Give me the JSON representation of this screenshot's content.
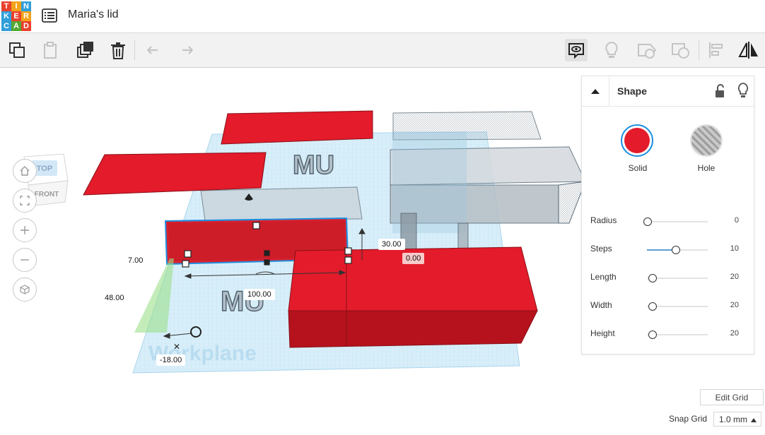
{
  "app": {
    "logo_letters": [
      "T",
      "I",
      "N",
      "K",
      "E",
      "R",
      "C",
      "A",
      "D"
    ],
    "design_title": "Maria's lid"
  },
  "colors": {
    "solid_red": "#e31b2b",
    "accent_blue": "#1f8fe0",
    "grid_blue": "#9fd3ee",
    "toolbar_bg": "#f2f2f2"
  },
  "toolbar": {
    "buttons": [
      {
        "name": "copy-icon",
        "enabled": true
      },
      {
        "name": "paste-icon",
        "enabled": false
      },
      {
        "name": "duplicate-icon",
        "enabled": true
      },
      {
        "name": "delete-icon",
        "enabled": true
      },
      {
        "name": "undo-icon",
        "enabled": false
      },
      {
        "name": "redo-icon",
        "enabled": false
      },
      {
        "name": "notes-icon",
        "enabled": true
      },
      {
        "name": "show-all-icon",
        "enabled": false
      },
      {
        "name": "group-icon",
        "enabled": false
      },
      {
        "name": "ungroup-icon",
        "enabled": false
      },
      {
        "name": "align-icon",
        "enabled": false
      },
      {
        "name": "mirror-icon",
        "enabled": true
      }
    ]
  },
  "viewcube": {
    "top": "TOP",
    "front": "FRONT"
  },
  "nav": [
    "home-icon",
    "fit-icon",
    "zoom-in-icon",
    "zoom-out-icon",
    "ortho-icon"
  ],
  "workplane_label": "Workplane",
  "scene_text": "MU",
  "dimensions": {
    "elevation": "7.00",
    "depth": "48.00",
    "height": "30.00",
    "rotation": "0.00",
    "length": "100.00",
    "offset": "-18.00"
  },
  "inspector": {
    "title": "Shape",
    "solid_label": "Solid",
    "hole_label": "Hole",
    "props": [
      {
        "name": "Radius",
        "value": "0",
        "pos": 0.0
      },
      {
        "name": "Steps",
        "value": "10",
        "pos": 0.46
      },
      {
        "name": "Length",
        "value": "20",
        "pos": 0.08
      },
      {
        "name": "Width",
        "value": "20",
        "pos": 0.08
      },
      {
        "name": "Height",
        "value": "20",
        "pos": 0.08
      }
    ]
  },
  "grid": {
    "edit_label": "Edit Grid",
    "snap_label": "Snap Grid",
    "snap_value": "1.0 mm"
  }
}
